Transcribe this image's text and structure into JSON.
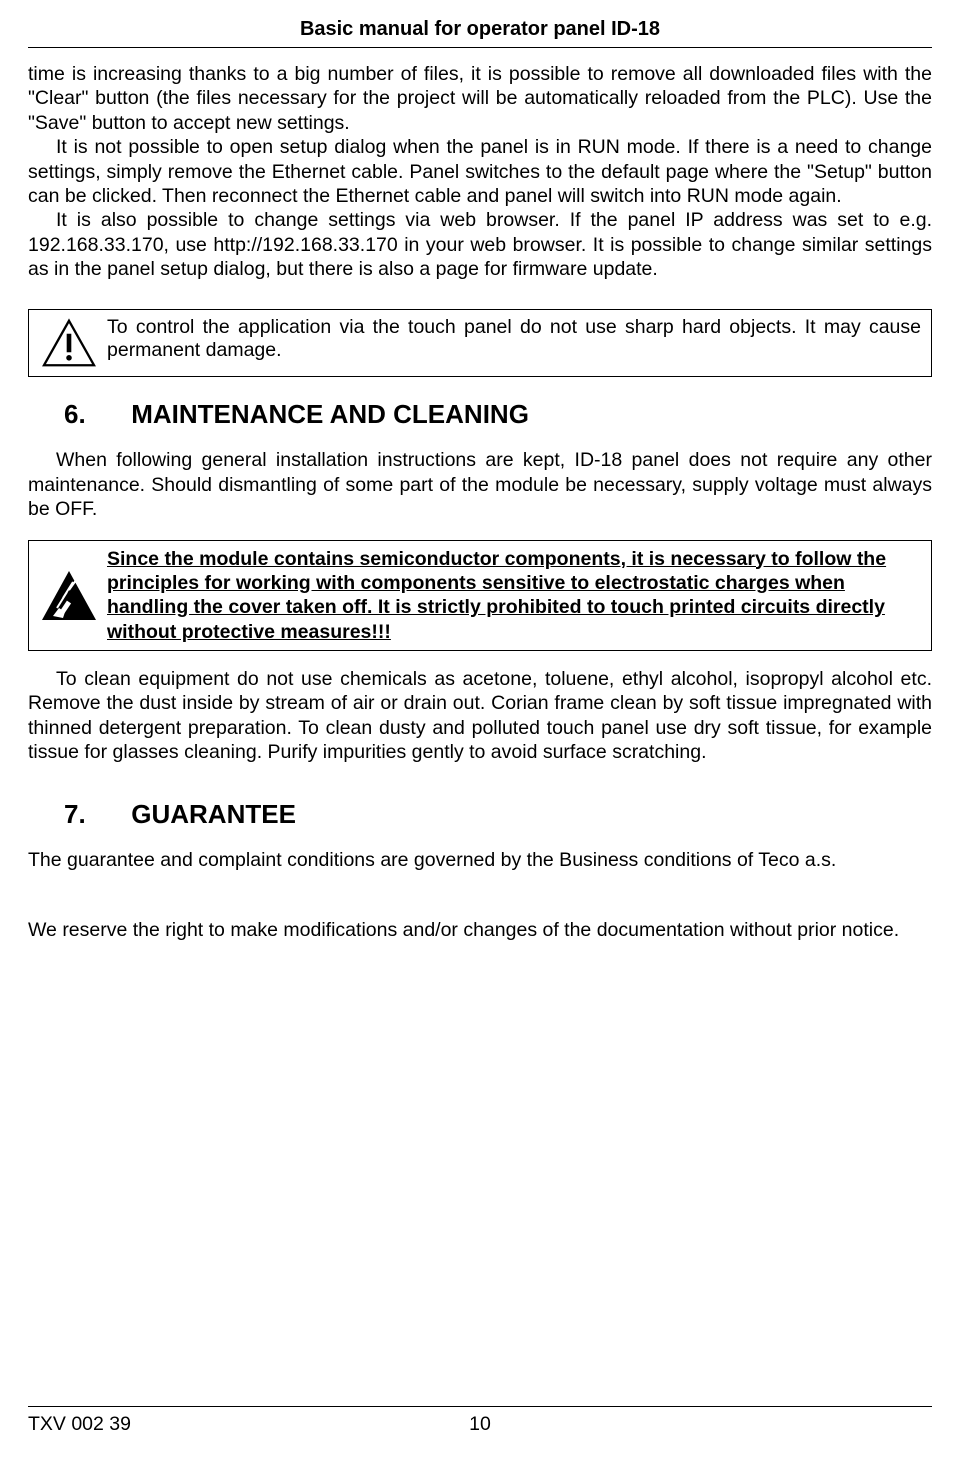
{
  "header": {
    "title": "Basic manual for operator panel ID-18"
  },
  "para1": "time is increasing thanks to a big number of files, it is possible to remove all downloaded files with the \"Clear\" button (the files necessary for the project will be automatically reloaded from the PLC). Use the \"Save\" button to accept new settings.",
  "para2": "It is not possible to open setup dialog when the panel is in RUN mode. If there is a need to change settings, simply remove the Ethernet cable. Panel switches to the default page where the \"Setup\" button can be clicked. Then reconnect the Ethernet cable and panel will switch into RUN mode again.",
  "para3": "It is also possible to change settings via web browser. If the panel IP address was set to e.g. 192.168.33.170, use http://192.168.33.170 in your web browser. It is possible to change similar settings as in the panel setup dialog, but there is also a page for firmware update.",
  "callout_warn": "To control the application via the touch panel do not use sharp hard objects. It may cause permanent damage.",
  "section6": {
    "num": "6.",
    "title": "MAINTENANCE AND CLEANING"
  },
  "para6a": "When following general installation instructions are kept, ID-18 panel does not require any other maintenance. Should dismantling of some part of the module be necessary, supply voltage must always be OFF.",
  "callout_esd": "Since the module contains semiconductor components, it is necessary to follow the principles for working with components sensitive to electrostatic charges when handling the cover taken off. It is strictly prohibited to touch printed circuits directly without protective measures!!!",
  "para6b": "To clean equipment do not use chemicals as acetone, toluene, ethyl alcohol, isopropyl alcohol etc. Remove the dust inside by stream of air or drain out. Corian frame clean by soft tissue impregnated with thinned detergent preparation. To clean dusty and polluted touch panel use dry soft tissue, for example tissue for glasses cleaning. Purify impurities gently to avoid surface scratching.",
  "section7": {
    "num": "7.",
    "title": "GUARANTEE"
  },
  "para7a": "The guarantee and complaint conditions are governed by the Business conditions of Teco a.s.",
  "para7b": "We reserve the right to make modifications and/or changes of the documentation without prior notice.",
  "footer": {
    "doc_ref": "TXV 002 39",
    "page": "10"
  }
}
